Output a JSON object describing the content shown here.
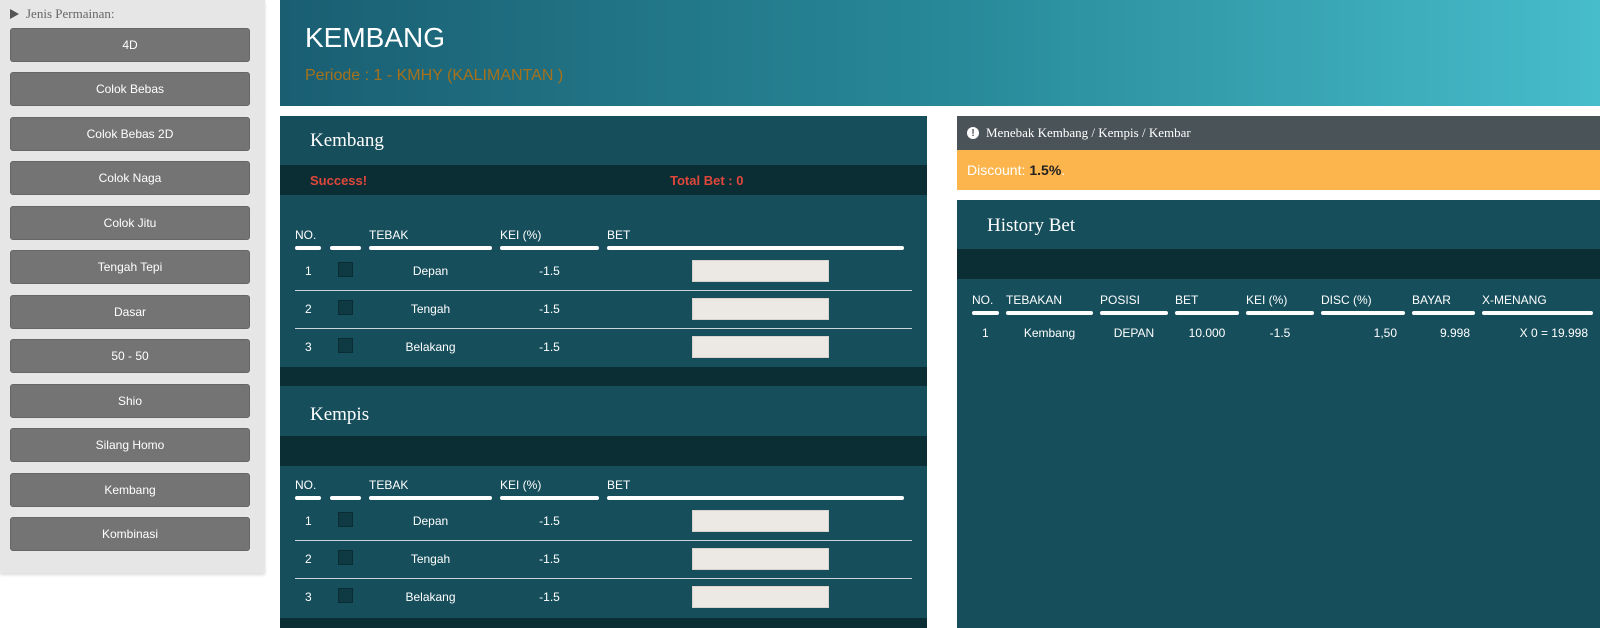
{
  "sidebar": {
    "header": "Jenis Permainan:",
    "items": [
      "4D",
      "Colok Bebas",
      "Colok Bebas 2D",
      "Colok Naga",
      "Colok Jitu",
      "Tengah Tepi",
      "Dasar",
      "50 - 50",
      "Shio",
      "Silang Homo",
      "Kembang",
      "Kombinasi"
    ]
  },
  "header": {
    "title": "KEMBANG",
    "periode": "Periode : 1 - KMHY (KALIMANTAN )"
  },
  "kembang": {
    "title": "Kembang",
    "success": "Success!",
    "total_bet": "Total Bet : 0",
    "columns": [
      "NO.",
      "TEBAK",
      "KEI (%)",
      "BET"
    ],
    "rows": [
      {
        "no": "1",
        "tebak": "Depan",
        "kei": "-1.5"
      },
      {
        "no": "2",
        "tebak": "Tengah",
        "kei": "-1.5"
      },
      {
        "no": "3",
        "tebak": "Belakang",
        "kei": "-1.5"
      }
    ]
  },
  "kempis": {
    "title": "Kempis",
    "columns": [
      "NO.",
      "TEBAK",
      "KEI (%)",
      "BET"
    ],
    "rows": [
      {
        "no": "1",
        "tebak": "Depan",
        "kei": "-1.5"
      },
      {
        "no": "2",
        "tebak": "Tengah",
        "kei": "-1.5"
      },
      {
        "no": "3",
        "tebak": "Belakang",
        "kei": "-1.5"
      }
    ]
  },
  "info": {
    "heading": "Menebak Kembang / Kempis / Kembar",
    "discount_label": "Discount:",
    "discount_value": "1.5%",
    "discount_suffix": "."
  },
  "history": {
    "title": "History Bet",
    "columns": [
      "NO.",
      "TEBAKAN",
      "POSISI",
      "BET",
      "KEI (%)",
      "DISC (%)",
      "BAYAR",
      "X-MENANG"
    ],
    "rows": [
      {
        "no": "1",
        "tebakan": "Kembang",
        "posisi": "DEPAN",
        "bet": "10.000",
        "kei": "-1.5",
        "disc": "1,50",
        "bayar": "9.998",
        "xmenang": "X 0 = 19.998"
      }
    ]
  },
  "colors": {
    "panel": "#164e5b",
    "strip": "#0b2e35",
    "accent_red": "#e0473a",
    "discount_bg": "#fcb44d",
    "button_gray": "#747474"
  }
}
